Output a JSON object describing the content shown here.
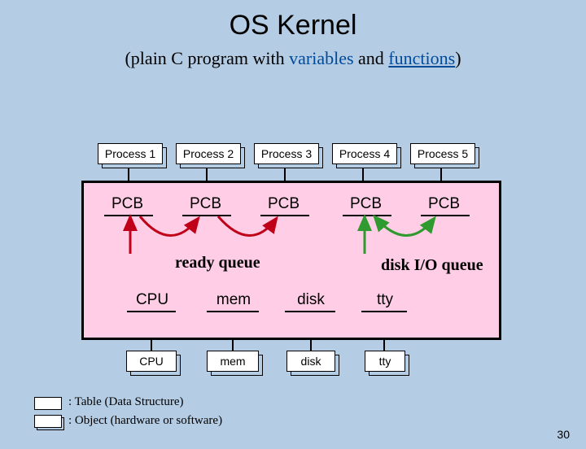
{
  "title": "OS Kernel",
  "subtitle": {
    "pre": "(plain C program with ",
    "vars": "variables",
    "mid": " and ",
    "funcs": "functions",
    "post": ")"
  },
  "processes": [
    "Process 1",
    "Process 2",
    "Process 3",
    "Process 4",
    "Process 5"
  ],
  "pcb": "PCB",
  "ready_queue": "ready queue",
  "disk_queue": "disk I/O queue",
  "devices": [
    "CPU",
    "mem",
    "disk",
    "tty"
  ],
  "hw": [
    "CPU",
    "mem",
    "disk",
    "tty"
  ],
  "legend": {
    "ds": ":  Table  (Data Structure)",
    "obj": ":  Object (hardware or software)"
  },
  "pagenum": "30",
  "colors": {
    "red": "#c00018",
    "green": "#2f9a2f"
  }
}
